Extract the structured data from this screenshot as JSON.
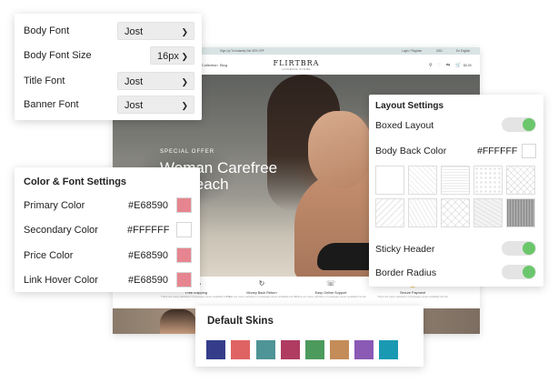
{
  "store": {
    "topbar_left": "Sign Up To Instantly Get 30% OFF",
    "topbar_right": [
      "Login / Register",
      "USD",
      "En English"
    ],
    "nav_links": [
      "Collection",
      "Blog"
    ],
    "logo": "FLIRTBRA",
    "tagline": "LINGERIE STORE",
    "icons": [
      "search-icon",
      "heart-icon",
      "compare-icon",
      "cart-icon"
    ],
    "cart_total": "$0.00",
    "hero": {
      "kicker": "SPECIAL OFFER",
      "title_line1": "Woman Carefree",
      "title_line2": "On Beach"
    },
    "features": [
      {
        "title": "Free Shipping",
        "desc": "There are many variations of passages ipsum available but the",
        "icon": "truck-icon"
      },
      {
        "title": "Money Back Return",
        "desc": "There are many variations of passages ipsum available but the",
        "icon": "money-back-icon"
      },
      {
        "title": "Easy Online Support",
        "desc": "There are many variations of passages ipsum available but the",
        "icon": "headset-icon"
      },
      {
        "title": "Secure Payment",
        "desc": "There are many variations of passages ipsum available but the",
        "icon": "lock-icon"
      }
    ]
  },
  "font_settings": {
    "rows": [
      {
        "label": "Body Font",
        "value": "Jost"
      },
      {
        "label": "Body Font Size",
        "value": "16px"
      },
      {
        "label": "Title Font",
        "value": "Jost"
      },
      {
        "label": "Banner Font",
        "value": "Jost"
      }
    ]
  },
  "color_settings": {
    "title": "Color & Font Settings",
    "rows": [
      {
        "label": "Primary Color",
        "value": "#E68590",
        "swatch": "#e68590"
      },
      {
        "label": "Secondary Color",
        "value": "#FFFFFF",
        "swatch": "#ffffff"
      },
      {
        "label": "Price Color",
        "value": "#E68590",
        "swatch": "#e68590"
      },
      {
        "label": "Link Hover Color",
        "value": "#E68590",
        "swatch": "#e68590"
      }
    ]
  },
  "layout_settings": {
    "title": "Layout Settings",
    "boxed_layout": {
      "label": "Boxed Layout",
      "on": true
    },
    "body_back_color": {
      "label": "Body Back Color",
      "value": "#FFFFFF",
      "swatch": "#ffffff"
    },
    "patterns": [
      "pattern-1",
      "pattern-2",
      "pattern-3",
      "pattern-4",
      "pattern-5",
      "pattern-6",
      "pattern-7",
      "pattern-8",
      "pattern-9",
      "pattern-10"
    ],
    "sticky_header": {
      "label": "Sticky Header",
      "on": true
    },
    "border_radius": {
      "label": "Border Radius",
      "on": true
    },
    "toggle_color": "#6cc76c"
  },
  "skins": {
    "title": "Default Skins",
    "colors": [
      "#353d8a",
      "#e06363",
      "#4f9496",
      "#b03c62",
      "#4d9a5d",
      "#c48c58",
      "#8a5ab5",
      "#1a9ab2"
    ]
  }
}
